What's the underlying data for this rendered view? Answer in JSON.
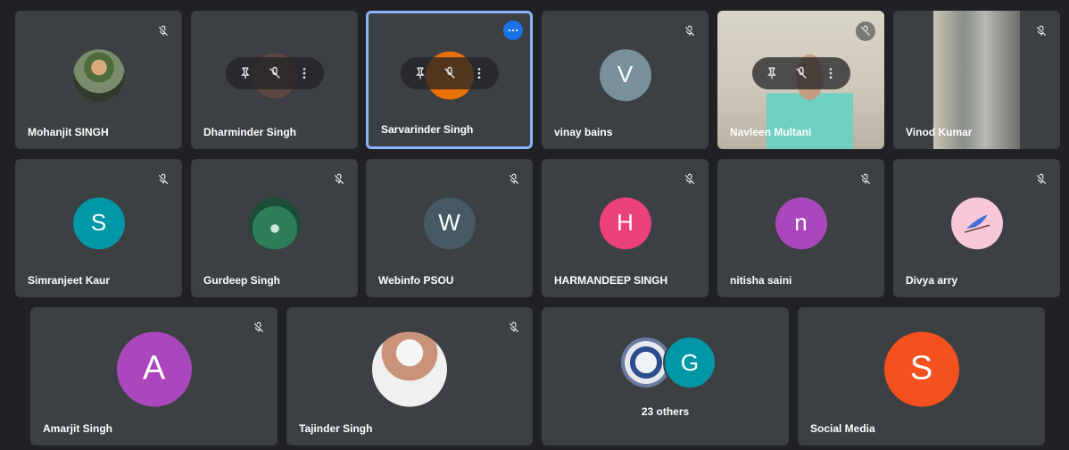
{
  "participants": [
    {
      "name": "Mohanjit SINGH"
    },
    {
      "name": "Dharminder Singh"
    },
    {
      "name": "Sarvarinder Singh"
    },
    {
      "name": "vinay bains",
      "initial": "V",
      "color": "#78909c"
    },
    {
      "name": "Navleen Multani"
    },
    {
      "name": "Vinod Kumar"
    },
    {
      "name": "Simranjeet Kaur",
      "initial": "S",
      "color": "#0097a7"
    },
    {
      "name": "Gurdeep Singh"
    },
    {
      "name": "Webinfo PSOU",
      "initial": "W",
      "color": "#455a64"
    },
    {
      "name": "HARMANDEEP SINGH",
      "initial": "H",
      "color": "#ec407a"
    },
    {
      "name": "nitisha saini",
      "initial": "n",
      "color": "#ab47bc"
    },
    {
      "name": "Divya arry"
    },
    {
      "name": "Amarjit Singh",
      "initial": "A",
      "color": "#ab47bc"
    },
    {
      "name": "Tajinder Singh"
    },
    {
      "name": "Social Media",
      "initial": "S",
      "color": "#f4511e"
    }
  ],
  "others": {
    "label": "23 others",
    "initial": "G",
    "color": "#0097a7"
  },
  "icons": {
    "mic_off": "mic-off-icon",
    "pin": "pin-icon",
    "more": "more-vert-icon",
    "options": "more-horiz-icon"
  },
  "colors": {
    "active_border": "#8ab4f8",
    "speaking": "#e8710a",
    "tile_bg": "#3c4043",
    "page_bg": "#202124"
  }
}
